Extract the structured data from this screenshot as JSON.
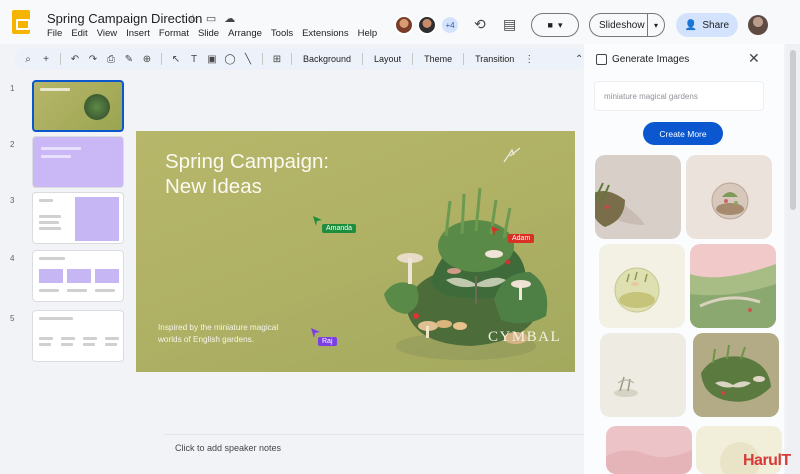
{
  "header": {
    "doc_title": "Spring Campaign Direction",
    "menu": [
      "File",
      "Edit",
      "View",
      "Insert",
      "Format",
      "Slide",
      "Arrange",
      "Tools",
      "Extensions",
      "Help"
    ],
    "more_collaborators": "+4",
    "slideshow_label": "Slideshow",
    "share_label": "Share"
  },
  "toolbar": {
    "background_label": "Background",
    "layout_label": "Layout",
    "theme_label": "Theme",
    "transition_label": "Transition"
  },
  "filmstrip": {
    "slides": [
      {
        "num": "1"
      },
      {
        "num": "2"
      },
      {
        "num": "3"
      },
      {
        "num": "4"
      },
      {
        "num": "5"
      }
    ]
  },
  "slide": {
    "title_line1": "Spring Campaign:",
    "title_line2": "New Ideas",
    "subtitle_line1": "Inspired by the miniature magical",
    "subtitle_line2": "worlds of English gardens.",
    "brand": "CYMBAL"
  },
  "cursors": [
    {
      "name": "Amanda",
      "color": "#1e8e3e"
    },
    {
      "name": "Adam",
      "color": "#d93025"
    },
    {
      "name": "Raj",
      "color": "#7b3fe4"
    }
  ],
  "notes": {
    "placeholder": "Click to add speaker notes"
  },
  "panel": {
    "title": "Generate Images",
    "prompt": "miniature magical gardens",
    "create_more_label": "Create More"
  },
  "watermark": "HarulT",
  "colors": {
    "accent": "#0b57d0",
    "share_bg": "#d3e3fd",
    "slide_bg": "#b2b268"
  }
}
